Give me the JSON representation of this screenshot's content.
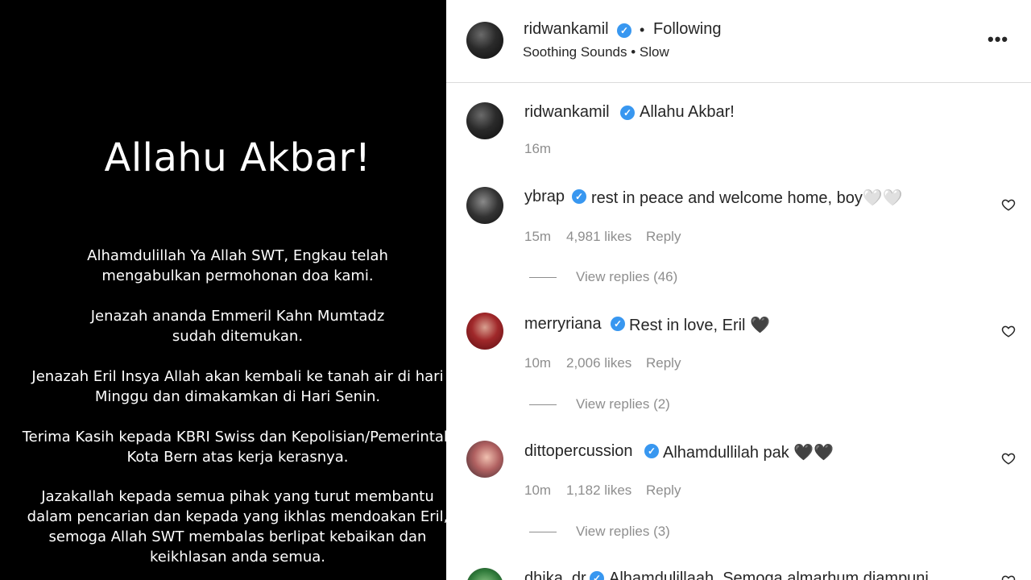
{
  "post_image": {
    "headline": "Allahu Akbar!",
    "paragraphs": [
      "Alhamdulillah Ya Allah SWT, Engkau telah\nmengabulkan permohonan doa kami.",
      "Jenazah ananda Emmeril Kahn Mumtadz\nsudah ditemukan.",
      "Jenazah Eril Insya Allah akan kembali ke tanah air di hari\nMinggu dan dimakamkan di Hari Senin.",
      "Terima Kasih kepada KBRI Swiss dan Kepolisian/Pemerintah\nKota Bern atas kerja kerasnya.",
      "Jazakallah kepada semua pihak yang turut membantu\ndalam pencarian dan kepada yang ikhlas mendoakan Eril,\nsemoga Allah SWT membalas berlipat kebaikan dan\nkeikhlasan anda semua."
    ]
  },
  "header": {
    "username": "ridwankamil",
    "separator": "•",
    "follow_status": "Following",
    "audio": "Soothing Sounds • Slow",
    "more": "•••"
  },
  "caption": {
    "username": "ridwankamil",
    "text": "Allahu Akbar!",
    "time": "16m"
  },
  "comments": [
    {
      "username": "ybrap",
      "text": "rest in peace and welcome home, boy🤍🤍",
      "time": "15m",
      "likes": "4,981 likes",
      "reply": "Reply",
      "view_replies": "View replies (46)"
    },
    {
      "username": "merryriana",
      "text": "Rest in love, Eril 🖤",
      "time": "10m",
      "likes": "2,006 likes",
      "reply": "Reply",
      "view_replies": "View replies (2)"
    },
    {
      "username": "dittopercussion",
      "text": "Alhamdullilah pak 🖤🖤",
      "time": "10m",
      "likes": "1,182 likes",
      "reply": "Reply",
      "view_replies": "View replies (3)"
    },
    {
      "username": "dhika_dr",
      "text": "Alhamdulillaah. Semoga almarhum diampuni"
    }
  ],
  "icons": {
    "verified": "verified-badge-icon",
    "heart": "heart-outline-icon",
    "more": "more-options-icon"
  },
  "colors": {
    "verified": "#3897f0",
    "muted_text": "#8e8e8e",
    "divider": "#dbdbdb"
  }
}
